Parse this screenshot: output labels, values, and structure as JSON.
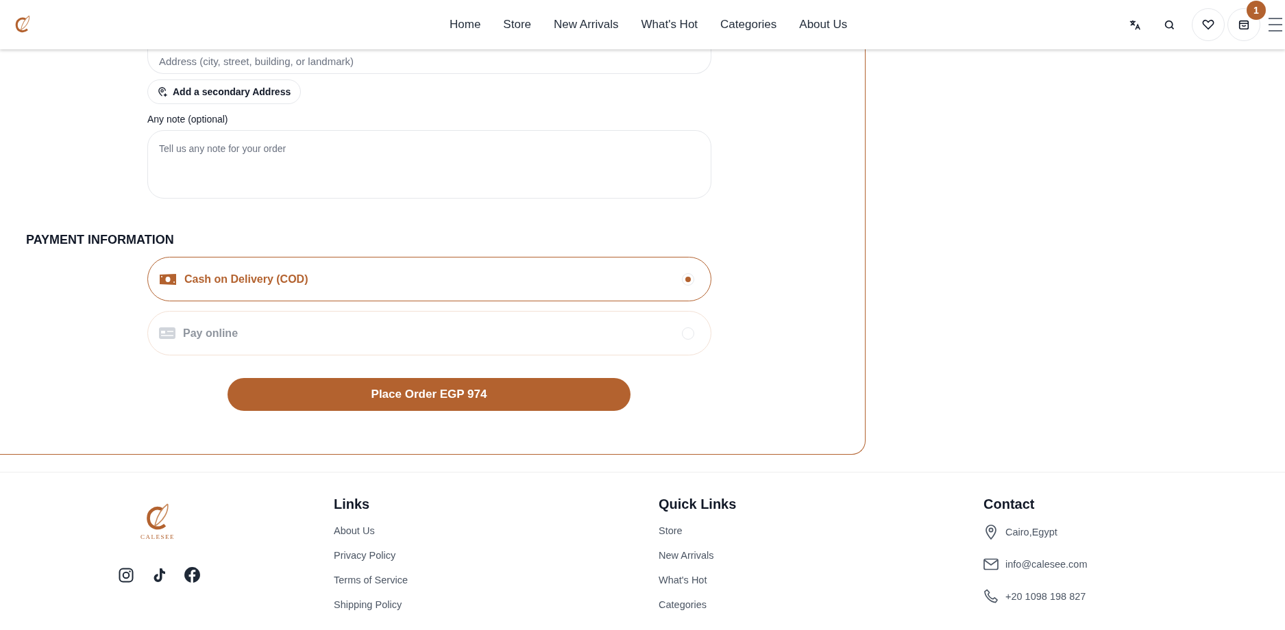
{
  "header": {
    "nav": [
      {
        "label": "Home"
      },
      {
        "label": "Store"
      },
      {
        "label": "New Arrivals"
      },
      {
        "label": "What's Hot"
      },
      {
        "label": "Categories"
      },
      {
        "label": "About Us"
      }
    ],
    "cart_count": "1"
  },
  "checkout": {
    "address_field": {
      "placeholder": "Address (city, street, building, or landmark)"
    },
    "secondary_address_button": "Add a secondary Address",
    "note": {
      "label": "Any note (optional)",
      "placeholder": "Tell us any note for your order"
    },
    "payment": {
      "title": "PAYMENT INFORMATION",
      "options": [
        {
          "label": "Cash on Delivery (COD)",
          "kind": "cash",
          "selected": true
        },
        {
          "label": "Pay online",
          "kind": "card",
          "selected": false
        }
      ]
    },
    "place_order_button": "Place Order EGP 974"
  },
  "footer": {
    "logo_text": "CALESEE",
    "columns": [
      {
        "title": "Links",
        "items": [
          "About Us",
          "Privacy Policy",
          "Terms of Service",
          "Shipping Policy"
        ]
      },
      {
        "title": "Quick Links",
        "items": [
          "Store",
          "New Arrivals",
          "What's Hot",
          "Categories"
        ]
      }
    ],
    "contact": {
      "title": "Contact",
      "items": [
        {
          "kind": "location",
          "text": "Cairo,Egypt"
        },
        {
          "kind": "email",
          "text": "info@calesee.com"
        },
        {
          "kind": "phone",
          "text": "+20 1098 198 827"
        }
      ]
    }
  }
}
